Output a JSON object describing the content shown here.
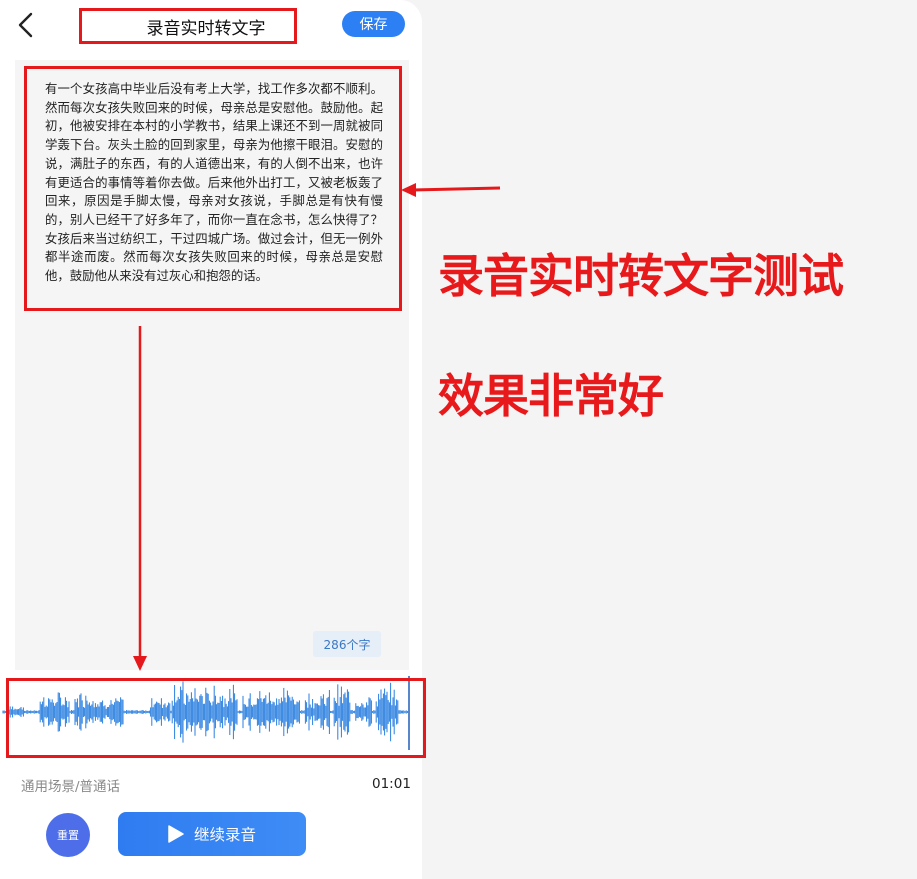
{
  "header": {
    "title": "录音实时转文字",
    "save_label": "保存",
    "back_icon": "chevron-left-icon"
  },
  "transcript": {
    "text": "有一个女孩高中毕业后没有考上大学，找工作多次都不顺利。然而每次女孩失败回来的时候，母亲总是安慰他。鼓励他。起初，他被安排在本村的小学教书，结果上课还不到一周就被同学轰下台。灰头土脸的回到家里，母亲为他擦干眼泪。安慰的说，满肚子的东西，有的人道德出来，有的人倒不出来，也许有更适合的事情等着你去做。后来他外出打工，又被老板轰了回来，原因是手脚太慢，母亲对女孩说，手脚总是有快有慢的，别人已经干了好多年了，而你一直在念书，怎么快得了？女孩后来当过纺织工，干过四城广场。做过会计，但无一例外都半途而废。然而每次女孩失败回来的时候，母亲总是安慰他，鼓励他从来没有过灰心和抱怨的话。",
    "char_count": "286个字"
  },
  "footer": {
    "scene": "通用场景/普通话",
    "duration": "01:01",
    "reset_label": "重置",
    "record_label": "继续录音",
    "play_icon": "play-icon"
  },
  "annotations": {
    "line1": "录音实时转文字测试",
    "line2": "效果非常好"
  },
  "colors": {
    "accent": "#2d7ff4",
    "annotation_red": "#e5191c",
    "waveform": "#2a7fe0",
    "reset_button": "#4d6ee8"
  }
}
